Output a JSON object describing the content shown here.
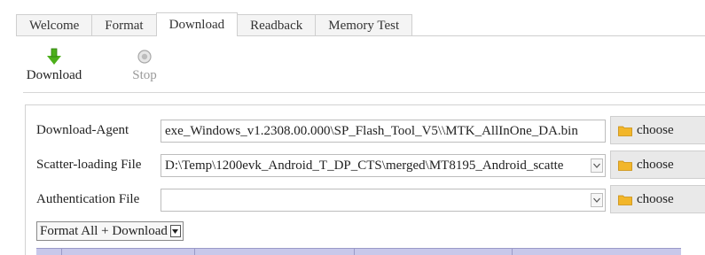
{
  "tabs": [
    {
      "label": "Welcome"
    },
    {
      "label": "Format"
    },
    {
      "label": "Download",
      "active": true
    },
    {
      "label": "Readback"
    },
    {
      "label": "Memory Test"
    }
  ],
  "toolbar": {
    "download_label": "Download",
    "download_icon": "arrow-down-icon",
    "stop_label": "Stop",
    "stop_icon": "stop-icon",
    "stop_enabled": false
  },
  "form": {
    "download_agent": {
      "label": "Download-Agent",
      "value": "exe_Windows_v1.2308.00.000\\SP_Flash_Tool_V5\\\\MTK_AllInOne_DA.bin",
      "button": "choose"
    },
    "scatter_file": {
      "label": "Scatter-loading File",
      "value": "D:\\Temp\\1200evk_Android_T_DP_CTS\\merged\\MT8195_Android_scatte",
      "button": "choose"
    },
    "auth_file": {
      "label": "Authentication File",
      "value": "",
      "button": "choose"
    },
    "mode": {
      "selected": "Format All + Download"
    }
  },
  "colors": {
    "download_arrow": "#4caf1a",
    "folder": "#f2b62a",
    "table_header": "#c8c8ea"
  }
}
